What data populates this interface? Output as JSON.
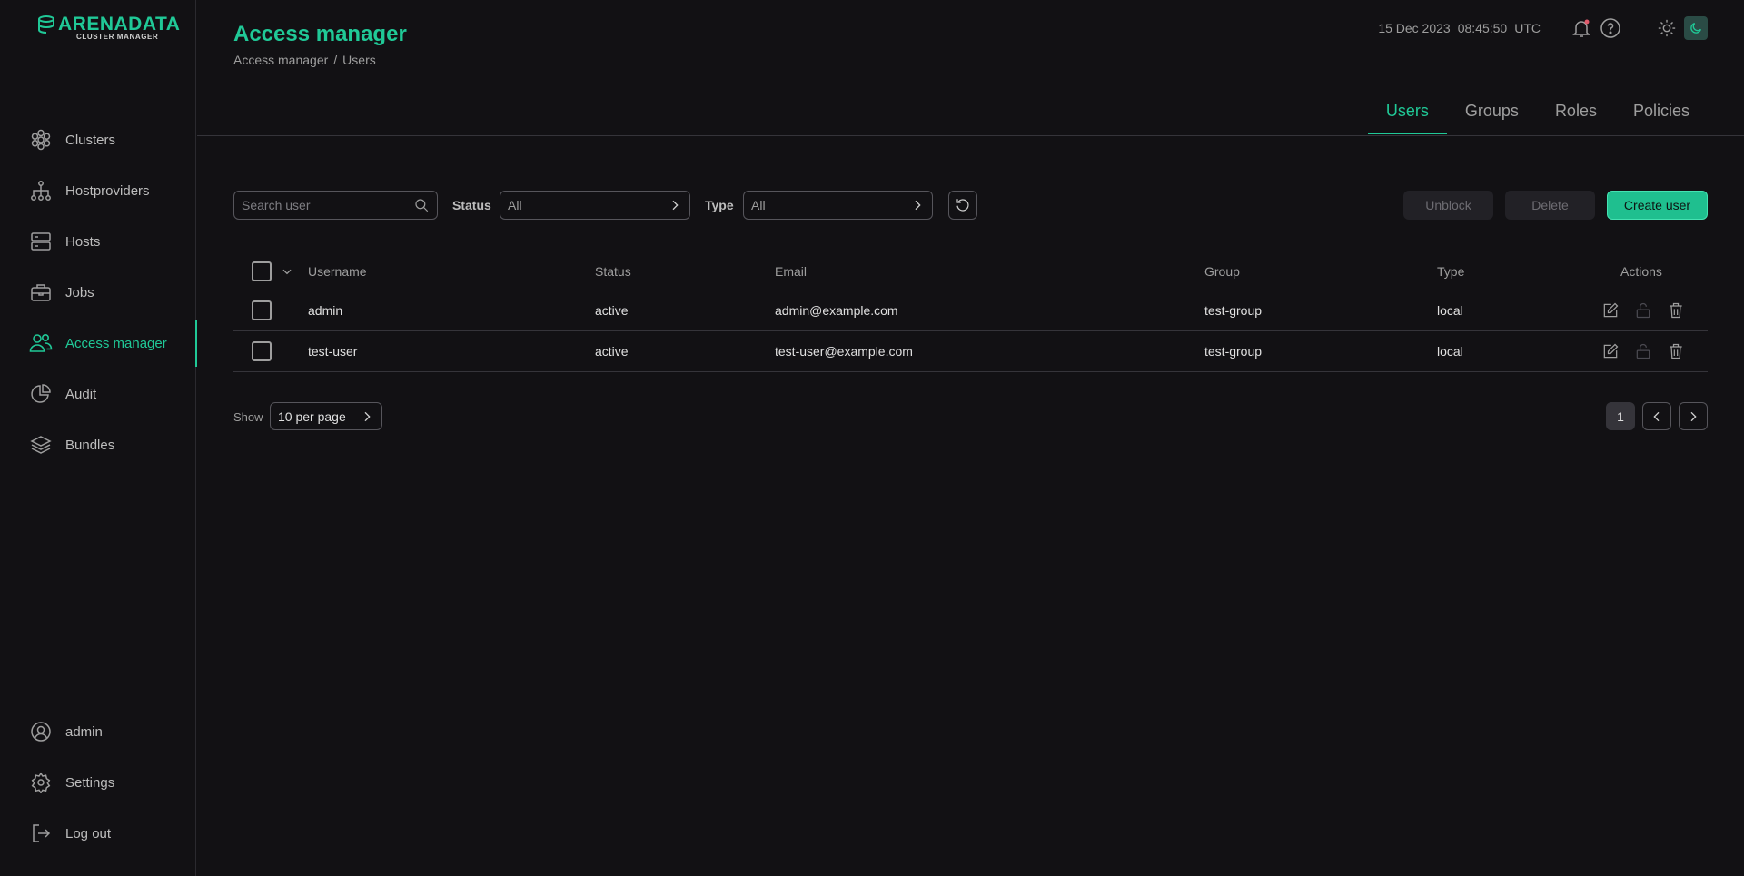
{
  "brand": {
    "name": "ARENADATA",
    "subtitle": "CLUSTER MANAGER"
  },
  "sidebar": {
    "items": [
      {
        "label": "Clusters",
        "icon": "clusters-icon"
      },
      {
        "label": "Hostproviders",
        "icon": "hostproviders-icon"
      },
      {
        "label": "Hosts",
        "icon": "hosts-icon"
      },
      {
        "label": "Jobs",
        "icon": "jobs-icon"
      },
      {
        "label": "Access manager",
        "icon": "users-icon",
        "active": true
      },
      {
        "label": "Audit",
        "icon": "audit-icon"
      },
      {
        "label": "Bundles",
        "icon": "bundles-icon"
      }
    ],
    "bottom": [
      {
        "label": "admin",
        "icon": "user-icon"
      },
      {
        "label": "Settings",
        "icon": "gear-icon"
      },
      {
        "label": "Log out",
        "icon": "logout-icon"
      }
    ]
  },
  "header": {
    "title": "Access manager",
    "breadcrumb": [
      "Access manager",
      "Users"
    ],
    "breadcrumb_separator": "/",
    "date": "15 Dec 2023",
    "time": "08:45:50",
    "timezone": "UTC"
  },
  "tabs": [
    {
      "label": "Users",
      "active": true
    },
    {
      "label": "Groups"
    },
    {
      "label": "Roles"
    },
    {
      "label": "Policies"
    }
  ],
  "toolbar": {
    "search_placeholder": "Search user",
    "status_label": "Status",
    "status_value": "All",
    "type_label": "Type",
    "type_value": "All",
    "unblock_label": "Unblock",
    "delete_label": "Delete",
    "create_label": "Create user"
  },
  "table": {
    "columns": [
      "Username",
      "Status",
      "Email",
      "Group",
      "Type",
      "Actions"
    ],
    "rows": [
      {
        "username": "admin",
        "status": "active",
        "email": "admin@example.com",
        "group": "test-group",
        "type": "local"
      },
      {
        "username": "test-user",
        "status": "active",
        "email": "test-user@example.com",
        "group": "test-group",
        "type": "local"
      }
    ]
  },
  "pagination": {
    "show_label": "Show",
    "per_page": "10 per page",
    "current_page": "1"
  },
  "colors": {
    "accent": "#20c997",
    "background": "#121114"
  }
}
